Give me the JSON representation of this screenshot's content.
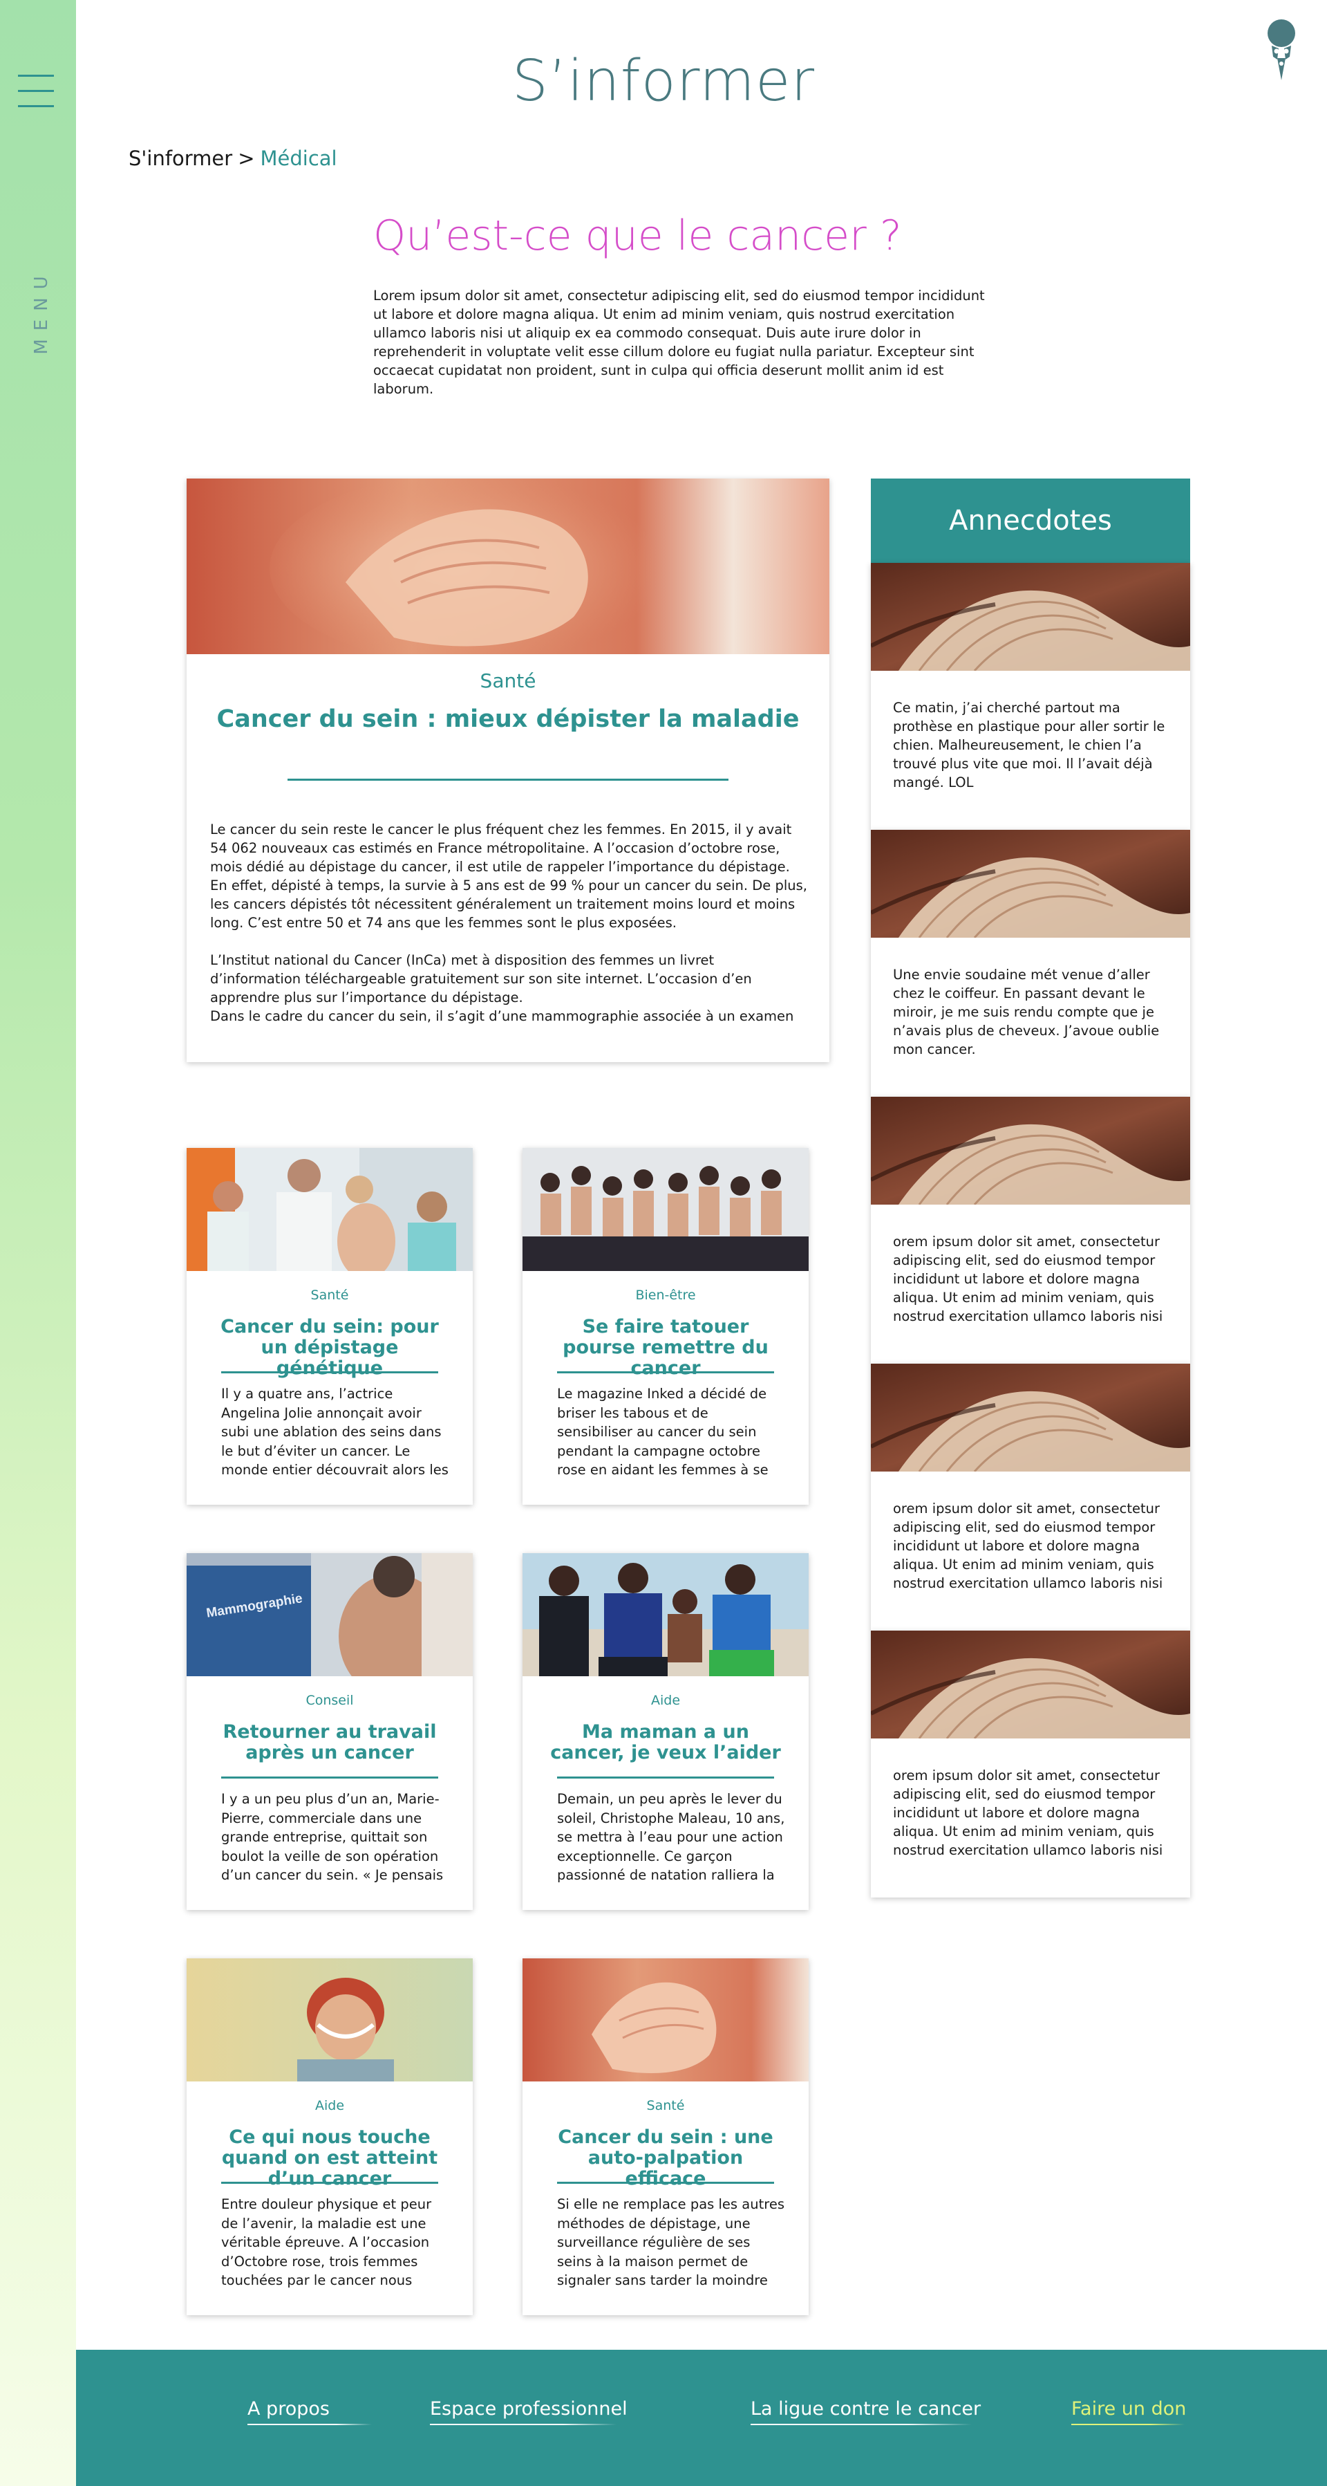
{
  "sidebar": {
    "menu_label": "MENU"
  },
  "header": {
    "title": "S’informer"
  },
  "breadcrumb": {
    "root": "S'informer",
    "separator": ">",
    "current": "Médical"
  },
  "intro": {
    "title": "Qu’est-ce que le cancer ?",
    "text": "Lorem ipsum dolor sit amet, consectetur adipiscing elit, sed do eiusmod tempor incididunt ut labore et dolore magna aliqua. Ut enim ad minim veniam, quis nostrud exercitation ullamco laboris nisi ut aliquip ex ea commodo consequat. Duis aute irure dolor in reprehenderit in voluptate velit esse cillum dolore eu fugiat nulla pariatur. Excepteur sint occaecat cupidatat non proident, sunt in culpa qui officia deserunt mollit anim id est laborum."
  },
  "featured": {
    "category": "Santé",
    "title": "Cancer du sein : mieux dépister la maladie",
    "paragraphs": [
      "Le cancer du sein reste le cancer le plus fréquent chez les femmes. En 2015, il y avait 54 062 nouveaux cas estimés en France métropolitaine. A l’occasion d’octobre rose, mois dédié au dépistage du cancer, il est utile de rappeler l’importance du dépistage.",
      "En effet, dépisté à temps,  la survie à 5 ans est de 99 % pour un cancer du sein. De plus, les cancers dépistés tôt nécessitent généralement un traitement moins lourd et moins long. C’est entre 50 et 74 ans que les femmes sont le plus exposées.",
      "L’Institut national du Cancer (InCa) met à disposition des femmes un livret d’information téléchargeable gratuitement sur son site internet. L’occasion d’en apprendre plus sur l’importance du dépistage.",
      "Dans le cadre du cancer du sein, il s’agit d’une mammographie associée à un examen"
    ]
  },
  "articles": [
    {
      "category": "Santé",
      "title": "Cancer du sein: pour un dépistage génétique",
      "excerpt": "Il y a quatre ans, l’actrice Angelina Jolie annonçait avoir subi une ablation des seins dans le but d’éviter un cancer. Le monde entier découvrait alors les gènes"
    },
    {
      "category": "Bien-être",
      "title": "Se faire tatouer pourse remettre du cancer",
      "excerpt": "Le magazine Inked a décidé de briser les tabous et de sensibiliser au cancer du sein pendant la campagne octobre rose en aidant les femmes à se reconstruire"
    },
    {
      "category": "Conseil",
      "title": "Retourner au travail après un cancer",
      "excerpt": "I y a un peu plus d’un an, Marie-Pierre, commerciale dans une grande entreprise, quittait son boulot la veille de son opération d’un cancer du sein. « Je pensais"
    },
    {
      "category": "Aide",
      "title": "Ma maman a un cancer, je veux l’aider",
      "excerpt": "Demain, un peu après le lever du soleil, Christophe Maleau, 10 ans, se mettra à l’eau pour une action exceptionnelle. Ce garçon passionné de natation ralliera la"
    },
    {
      "category": "Aide",
      "title": "Ce qui nous touche quand on est atteint d’un cancer",
      "excerpt": "Entre douleur physique et peur de l’avenir, la maladie est une véritable épreuve. A l’occasion d’Octobre rose, trois femmes touchées par le cancer nous"
    },
    {
      "category": "Santé",
      "title": "Cancer du sein : une auto-palpation efficace",
      "excerpt": "Si elle ne remplace pas les autres méthodes de dépistage, une surveillance régulière de ses seins à la maison permet de signaler sans tarder la moindre petite"
    }
  ],
  "image_badges": {
    "mammographie": "Mammographie"
  },
  "anecdotes": {
    "title": "Annecdotes",
    "items": [
      "Ce matin, j’ai cherché partout ma prothèse en plastique pour aller sortir le chien. Malheureusement, le chien l’a trouvé plus vite que moi. Il l’avait déjà mangé. LOL",
      "Une envie soudaine mét venue d’aller chez le coiffeur. En passant devant le miroir, je me suis rendu compte que je n’avais plus de cheveux. J’avoue oublie mon cancer.",
      "orem ipsum dolor sit amet, consectetur adipiscing elit, sed do eiusmod tempor incididunt ut labore et dolore magna aliqua. Ut enim ad minim veniam, quis nostrud exercitation ullamco laboris nisi ut",
      "orem ipsum dolor sit amet, consectetur adipiscing elit, sed do eiusmod tempor incididunt ut labore et dolore magna aliqua. Ut enim ad minim veniam, quis nostrud exercitation ullamco laboris nisi ut",
      "orem ipsum dolor sit amet, consectetur adipiscing elit, sed do eiusmod tempor incididunt ut labore et dolore magna aliqua. Ut enim ad minim veniam, quis nostrud exercitation ullamco laboris nisi ut"
    ]
  },
  "footer": {
    "links": [
      "A propos",
      "Espace professionnel",
      "La ligue contre le cancer",
      "Faire un don"
    ]
  },
  "colors": {
    "teal": "#2e9290",
    "pink_title": "#d54dc9",
    "sidebar_green": "#a3e1ab",
    "donate": "#dff27a"
  },
  "icons": {
    "menu": "hamburger-icon",
    "logo": "ribbon-logo-icon"
  }
}
